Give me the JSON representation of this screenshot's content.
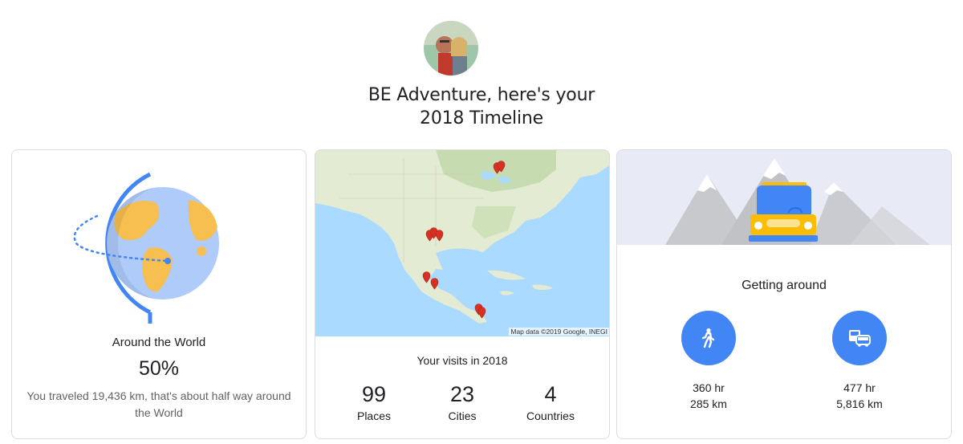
{
  "header": {
    "headline_line1": "BE Adventure, here's your",
    "headline_line2": "2018 Timeline"
  },
  "around_world": {
    "title": "Around the World",
    "percent": "50%",
    "description": "You traveled 19,436 km, that's about half way around the World",
    "progress_fraction": 0.5
  },
  "visits": {
    "map_attribution": "Map data ©2019 Google, INEGI",
    "title": "Your visits in 2018",
    "stats": [
      {
        "value": "99",
        "label": "Places"
      },
      {
        "value": "23",
        "label": "Cities"
      },
      {
        "value": "4",
        "label": "Countries"
      }
    ]
  },
  "getting_around": {
    "title": "Getting around",
    "modes": [
      {
        "icon": "walking-icon",
        "time": "360 hr",
        "distance": "285 km"
      },
      {
        "icon": "vehicle-icon",
        "time": "477 hr",
        "distance": "5,816 km"
      }
    ]
  },
  "colors": {
    "accent_blue": "#4285f4",
    "globe_yellow": "#f6bf4f",
    "globe_blue": "#aecbfa",
    "pin_red": "#d93025"
  }
}
